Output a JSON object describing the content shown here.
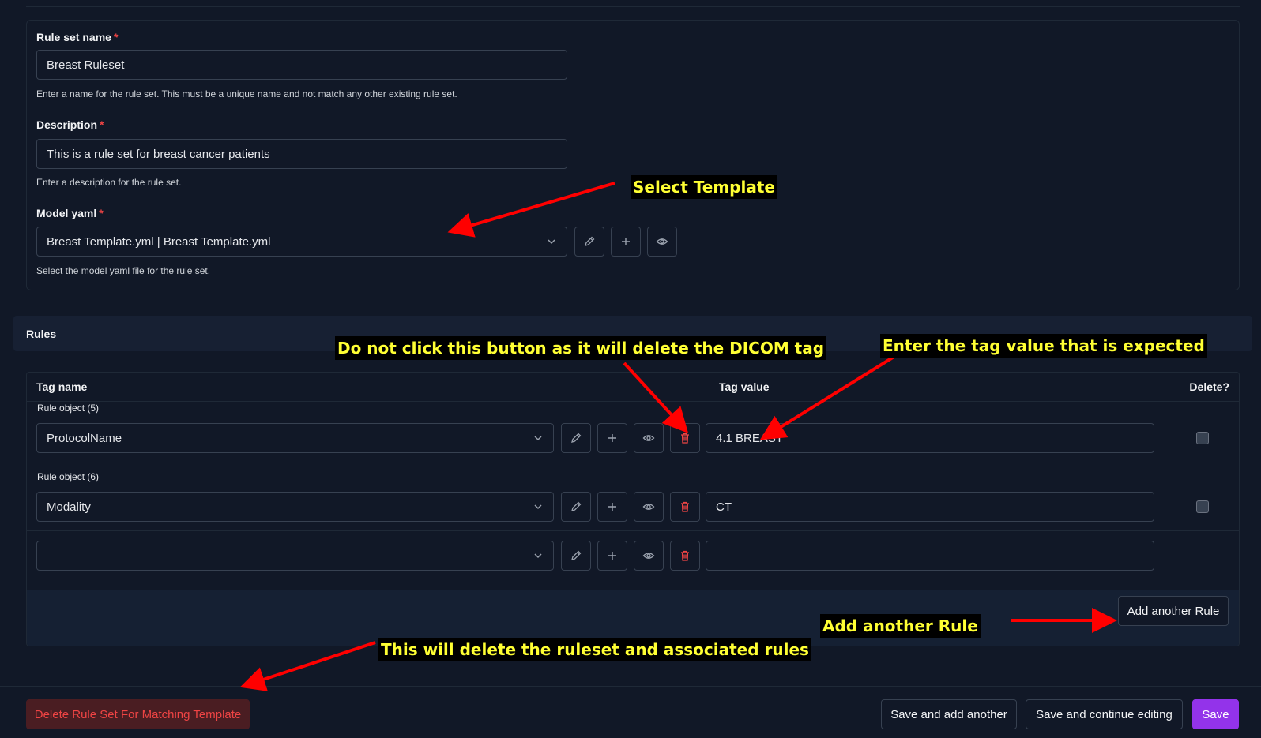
{
  "form": {
    "rule_set_name": {
      "label": "Rule set name",
      "required_mark": "*",
      "value": "Breast Ruleset",
      "help": "Enter a name for the rule set. This must be a unique name and not match any other existing rule set."
    },
    "description": {
      "label": "Description",
      "required_mark": "*",
      "value": "This is a rule set for breast cancer patients",
      "help": "Enter a description for the rule set."
    },
    "model_yaml": {
      "label": "Model yaml",
      "required_mark": "*",
      "value": "Breast Template.yml | Breast Template.yml",
      "help": "Select the model yaml file for the rule set."
    }
  },
  "rules": {
    "section_title": "Rules",
    "columns": {
      "tag_name": "Tag name",
      "tag_value": "Tag value",
      "delete": "Delete?"
    },
    "rows": [
      {
        "label": "Rule object (5)",
        "tag_name": "ProtocolName",
        "tag_value": "4.1 BREAST"
      },
      {
        "label": "Rule object (6)",
        "tag_name": "Modality",
        "tag_value": "CT"
      },
      {
        "label": "",
        "tag_name": "",
        "tag_value": ""
      }
    ],
    "add_button": "Add another Rule"
  },
  "footer": {
    "delete_button": "Delete Rule Set For Matching Template",
    "save_add_another": "Save and add another",
    "save_continue": "Save and continue editing",
    "save": "Save"
  },
  "annotations": {
    "select_template": "Select Template",
    "do_not_click": "Do not click this button as it will delete the DICOM tag",
    "enter_tag_value": "Enter the tag value that is expected",
    "add_another_rule": "Add another Rule",
    "delete_ruleset": "This will delete the ruleset and associated rules"
  },
  "colors": {
    "background": "#111827",
    "danger": "#ef4444",
    "primary": "#9333ea",
    "annotation_text": "#ffff33",
    "annotation_arrow": "#ff0000"
  },
  "icons": [
    "chevron-down-icon",
    "pencil-icon",
    "plus-icon",
    "eye-icon",
    "trash-icon"
  ]
}
